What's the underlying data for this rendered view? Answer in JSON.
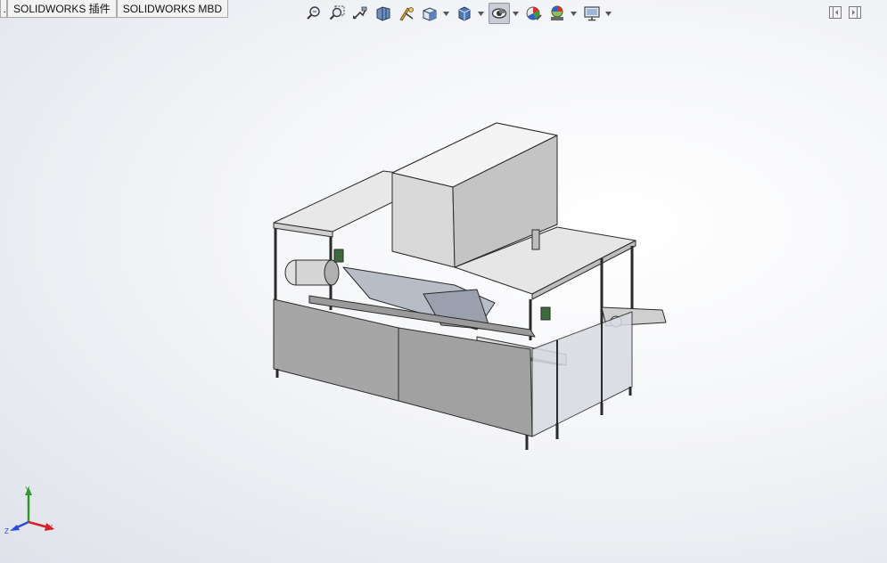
{
  "tabs": [
    {
      "label": "…",
      "truncated": true
    },
    {
      "label": "SOLIDWORKS 插件"
    },
    {
      "label": "SOLIDWORKS MBD"
    }
  ],
  "heads_up_toolbar": [
    {
      "icon": "zoom-to-fit-icon"
    },
    {
      "icon": "zoom-to-area-icon"
    },
    {
      "icon": "previous-view-icon"
    },
    {
      "icon": "section-view-icon"
    },
    {
      "icon": "dynamic-annotation-views-icon"
    },
    {
      "icon": "view-orientation-icon",
      "dropdown": true
    },
    {
      "icon": "display-style-icon",
      "dropdown": true
    },
    {
      "icon": "hide-show-items-icon",
      "dropdown": true,
      "active": true
    },
    {
      "icon": "edit-appearance-icon"
    },
    {
      "icon": "apply-scene-icon",
      "dropdown": true
    },
    {
      "icon": "view-settings-icon",
      "dropdown": true
    }
  ],
  "window_controls": [
    {
      "icon": "collapse-left-icon"
    },
    {
      "icon": "expand-right-icon"
    }
  ],
  "triad": {
    "x": "X",
    "y": "Y",
    "z": "Z"
  },
  "colors": {
    "triad_x": "#d2232a",
    "triad_y": "#2e9a2e",
    "triad_z": "#2b4bd6",
    "model_gray": "#a8a8a8",
    "model_light": "#e4e4e4"
  }
}
